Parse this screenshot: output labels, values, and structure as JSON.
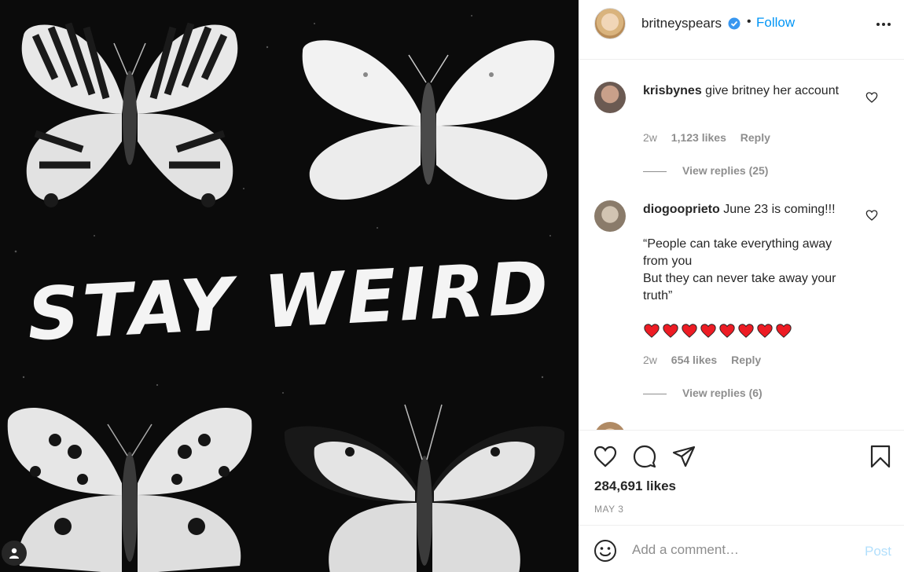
{
  "post": {
    "overlay_text": "STAY WEIRD"
  },
  "header": {
    "username": "britneyspears",
    "separator": "•",
    "follow_label": "Follow",
    "verified_icon": "verified-badge-icon",
    "more_icon": "more-options-icon"
  },
  "comments": [
    {
      "username": "krisbynes",
      "text": " give britney her account",
      "time": "2w",
      "likes": "1,123 likes",
      "reply_label": "Reply",
      "view_replies": "View replies (25)"
    },
    {
      "username": "diogooprieto",
      "text": " June 23 is coming!!!",
      "quote_line1": "“People can take everything away from you",
      "quote_line2": "But they can never take away your truth”",
      "hearts_count": 8,
      "time": "2w",
      "likes": "654 likes",
      "reply_label": "Reply",
      "view_replies": "View replies (6)"
    }
  ],
  "actions": {
    "like_icon": "heart-icon",
    "comment_icon": "comment-bubble-icon",
    "share_icon": "paper-plane-icon",
    "save_icon": "bookmark-icon",
    "likes_count": "284,691 likes",
    "date": "MAY 3"
  },
  "add_comment": {
    "placeholder": "Add a comment…",
    "post_label": "Post",
    "emoji_icon": "smiley-icon"
  },
  "colors": {
    "link": "#0095f6",
    "muted": "#8e8e8e",
    "post_disabled": "#b2dffc",
    "heart_red": "#ed1c24"
  }
}
